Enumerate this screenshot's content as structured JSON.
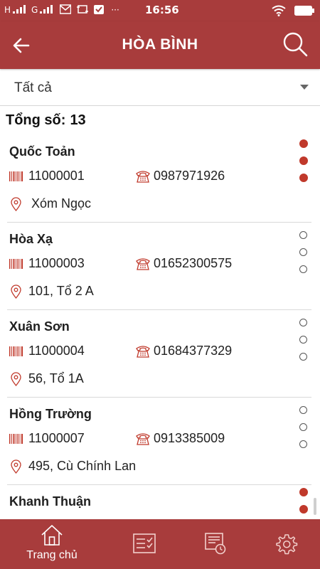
{
  "statusbar": {
    "network": "H",
    "carrier": "G",
    "overflow": "···",
    "time": "16:56"
  },
  "appbar": {
    "title": "HÒA BÌNH",
    "back_icon": "arrow-left-icon",
    "search_icon": "search-icon"
  },
  "filter": {
    "selected": "Tất cả"
  },
  "total": {
    "label": "Tổng số:",
    "count": "13"
  },
  "customers": [
    {
      "name": "Quốc Toản",
      "code": "11000001",
      "phone": "0987971926",
      "address": "Xóm Ngọc",
      "status_dots": [
        "filled",
        "filled",
        "filled"
      ]
    },
    {
      "name": "Hòa Xạ",
      "code": "11000003",
      "phone": "01652300575",
      "address": "101, Tổ 2 A",
      "status_dots": [
        "empty",
        "empty",
        "empty"
      ]
    },
    {
      "name": "Xuân Sơn",
      "code": "11000004",
      "phone": "01684377329",
      "address": "56, Tổ 1A",
      "status_dots": [
        "empty",
        "empty",
        "empty"
      ]
    },
    {
      "name": "Hồng Trường",
      "code": "11000007",
      "phone": "0913385009",
      "address": "495, Cù Chính Lan",
      "status_dots": [
        "empty",
        "empty",
        "empty"
      ]
    },
    {
      "name": "Khanh Thuận",
      "code": "",
      "phone": "",
      "address": "",
      "status_dots": [
        "filled",
        "filled"
      ]
    }
  ],
  "bottom_nav": {
    "home_label": "Trang chủ",
    "tabs": [
      "home-icon",
      "checklist-icon",
      "history-icon",
      "settings-icon"
    ]
  },
  "colors": {
    "primary": "#a83c3c",
    "dot_active": "#c0392b",
    "icon_accent": "#c0392b"
  }
}
